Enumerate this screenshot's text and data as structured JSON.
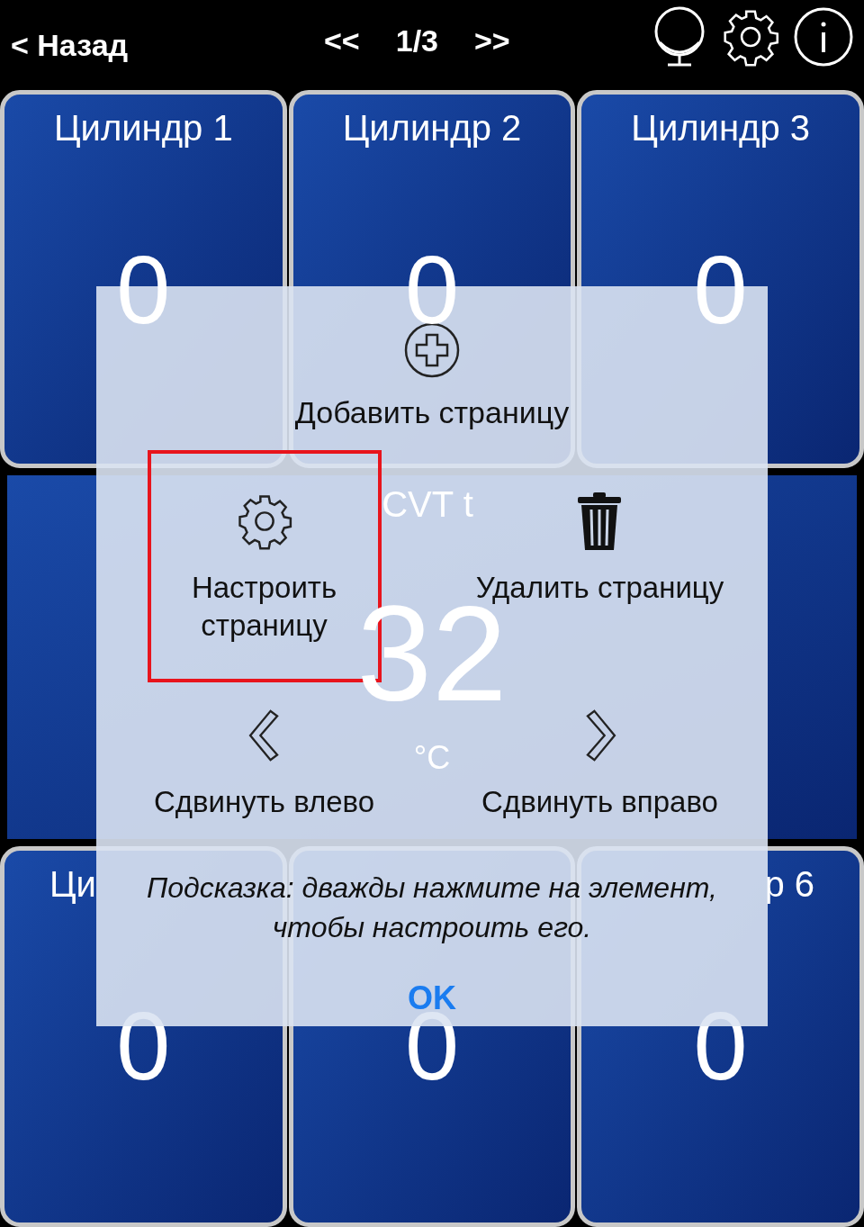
{
  "top_bar": {
    "back": "< Назад",
    "prev": "<<",
    "page": "1/3",
    "next": ">>"
  },
  "tiles_top": [
    {
      "title": "Цилиндр 1",
      "value": "0"
    },
    {
      "title": "Цилиндр 2",
      "value": "0"
    },
    {
      "title": "Цилиндр 3",
      "value": "0"
    }
  ],
  "wide_tile": {
    "title": "CVT t",
    "value": "32",
    "unit": "°C"
  },
  "tiles_bottom": [
    {
      "title": "Ци",
      "value": "0"
    },
    {
      "value": "0"
    },
    {
      "title": "р 6",
      "value": "0"
    }
  ],
  "dialog": {
    "add": {
      "label": "Добавить страницу"
    },
    "actions": [
      {
        "kind": "configure",
        "label": "Настроить страницу",
        "highlighted": true
      },
      {
        "kind": "delete",
        "label": "Удалить страницу",
        "highlighted": false
      },
      {
        "kind": "move_left",
        "label": "Сдвинуть влево",
        "highlighted": false
      },
      {
        "kind": "move_right",
        "label": "Сдвинуть вправо",
        "highlighted": false
      }
    ],
    "hint": "Подсказка: дважды нажмите на элемент, чтобы настроить его.",
    "ok": "OK"
  }
}
